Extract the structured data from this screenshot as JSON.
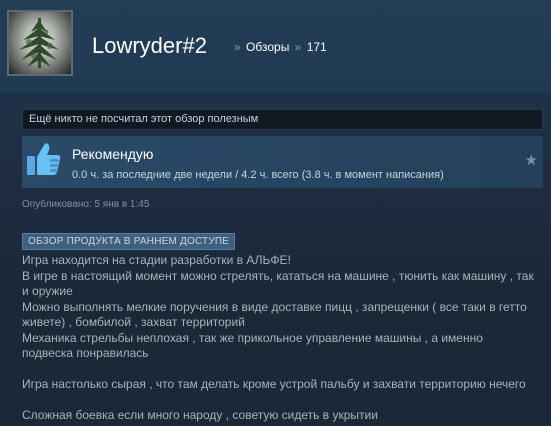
{
  "profile": {
    "name": "Lowryder#2",
    "breadcrumb": [
      {
        "label": "Обзоры"
      },
      {
        "label": "171"
      }
    ],
    "separator": "»"
  },
  "helpful_notice": "Ещё никто не посчитал этот обзор полезным",
  "recommendation": {
    "title": "Рекомендую",
    "hours": "0.0 ч. за последние две недели / 4.2 ч. всего (3.8 ч. в момент написания)",
    "icon": "thumbs-up-icon",
    "award_icon": "star-icon"
  },
  "posted": "Опубликовано: 5 янв в 1:45",
  "early_access_badge": "ОБЗОР ПРОДУКТА В РАННЕМ ДОСТУПЕ",
  "review_lines": [
    "Игра находится на стадии разработки в АЛЬФЕ!",
    "В игре в настоящий момент можно стрелять, кататься на машине , тюнить как машину , так и оружие",
    "Можно выполнять мелкие поручения в виде доставке пицц , запрещенки ( все таки в гетто живете) , бомбилой , захват территорий",
    "Механика стрельбы неплохая , так же прикольное управление машины , а именно подвеска понравилась",
    "",
    "Игра настолько сырая , что там делать кроме устрой пальбу и захвати территорию нечего",
    "",
    "Сложная боевка если много народу , советую сидеть в укрытии"
  ],
  "colors": {
    "background": "#1b2838",
    "accent_blue": "#3e5f80",
    "text_muted": "#acb2b8"
  }
}
